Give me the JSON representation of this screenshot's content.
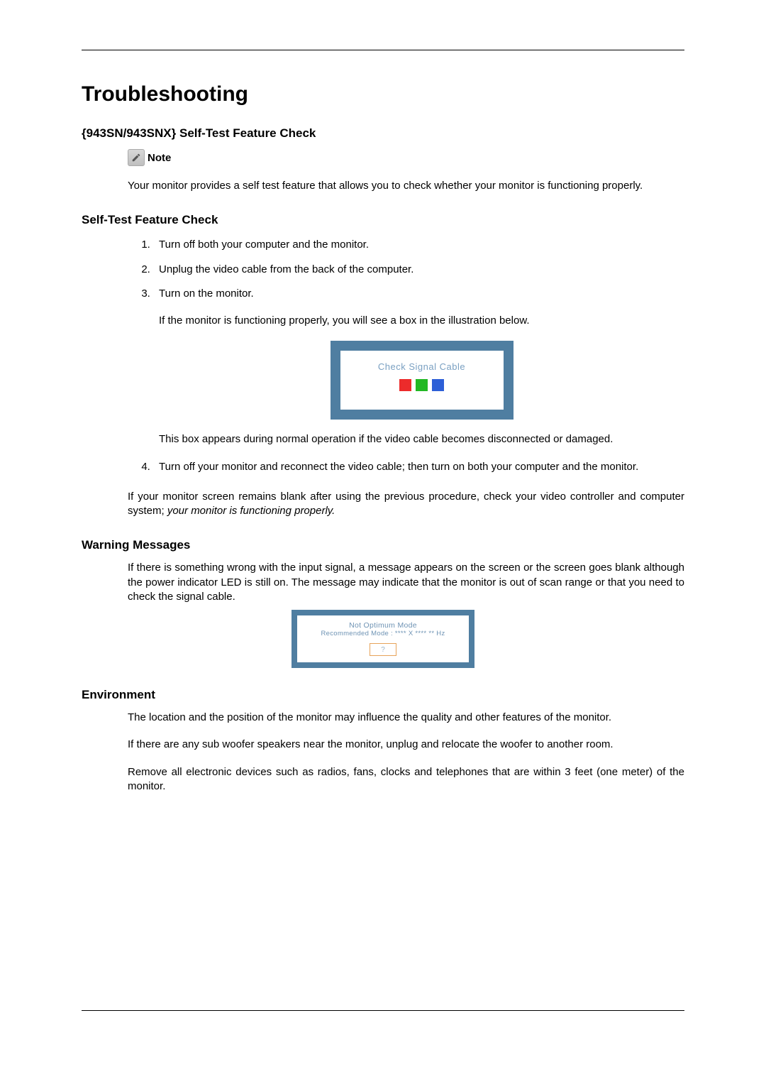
{
  "title": "Troubleshooting",
  "section1": {
    "heading": "{943SN/943SNX} Self-Test Feature Check",
    "note_label": "Note",
    "note_body": "Your monitor provides a self test feature that allows you to check whether your monitor is functioning properly."
  },
  "section2": {
    "heading": "Self-Test Feature Check",
    "steps": {
      "s1": "Turn off both your computer and the monitor.",
      "s2": "Unplug the video cable from the back of the computer.",
      "s3": "Turn on the monitor.",
      "s3_after": "If the monitor is functioning properly, you will see a box in the illustration below.",
      "illus1_text": "Check Signal Cable",
      "s3_after2": "This box appears during normal operation if the video cable becomes disconnected or damaged.",
      "s4": "Turn off your monitor and reconnect the video cable; then turn on both your computer and the monitor."
    },
    "conclusion_a": "If your monitor screen remains blank after using the previous procedure, check your video controller and computer system; ",
    "conclusion_b": "your monitor is functioning properly."
  },
  "warning": {
    "heading": "Warning Messages",
    "body": "If there is something wrong with the input signal, a message appears on the screen or the screen goes blank although the power indicator LED is still on. The message may indicate that the monitor is out of scan range or that you need to check the signal cable.",
    "illus2_line1": "Not Optimum Mode",
    "illus2_line2": "Recommended Mode : **** X **** ** Hz",
    "illus2_btn": "?"
  },
  "env": {
    "heading": "Environment",
    "p1": "The location and the position of the monitor may influence the quality and other features of the monitor.",
    "p2": "If there are any sub woofer speakers near the monitor, unplug and relocate the woofer to another room.",
    "p3": "Remove all electronic devices such as radios, fans, clocks and telephones that are within 3 feet (one meter) of the monitor."
  }
}
